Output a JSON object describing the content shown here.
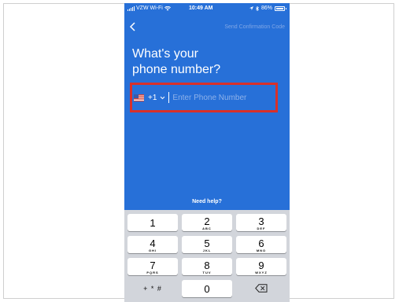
{
  "status_bar": {
    "carrier": "VZW Wi-Fi",
    "time": "10:49 AM",
    "battery": "86%"
  },
  "header": {
    "send_confirmation_label": "Send Confirmation Code"
  },
  "title_lines": [
    "What's your",
    "phone number?"
  ],
  "phone_input": {
    "country_code": "+1",
    "placeholder": "Enter Phone Number",
    "value": ""
  },
  "help_link": "Need help?",
  "keypad": {
    "keys": [
      {
        "num": "1",
        "letters": ""
      },
      {
        "num": "2",
        "letters": "ABC"
      },
      {
        "num": "3",
        "letters": "DEF"
      },
      {
        "num": "4",
        "letters": "GHI"
      },
      {
        "num": "5",
        "letters": "JKL"
      },
      {
        "num": "6",
        "letters": "MNO"
      },
      {
        "num": "7",
        "letters": "PQRS"
      },
      {
        "num": "8",
        "letters": "TUV"
      },
      {
        "num": "9",
        "letters": "WXYZ"
      }
    ],
    "symbols": "+ * #",
    "zero": "0"
  },
  "colors": {
    "background": "#2770d8",
    "highlight": "#d8302a",
    "keyboard": "#d2d5db"
  }
}
